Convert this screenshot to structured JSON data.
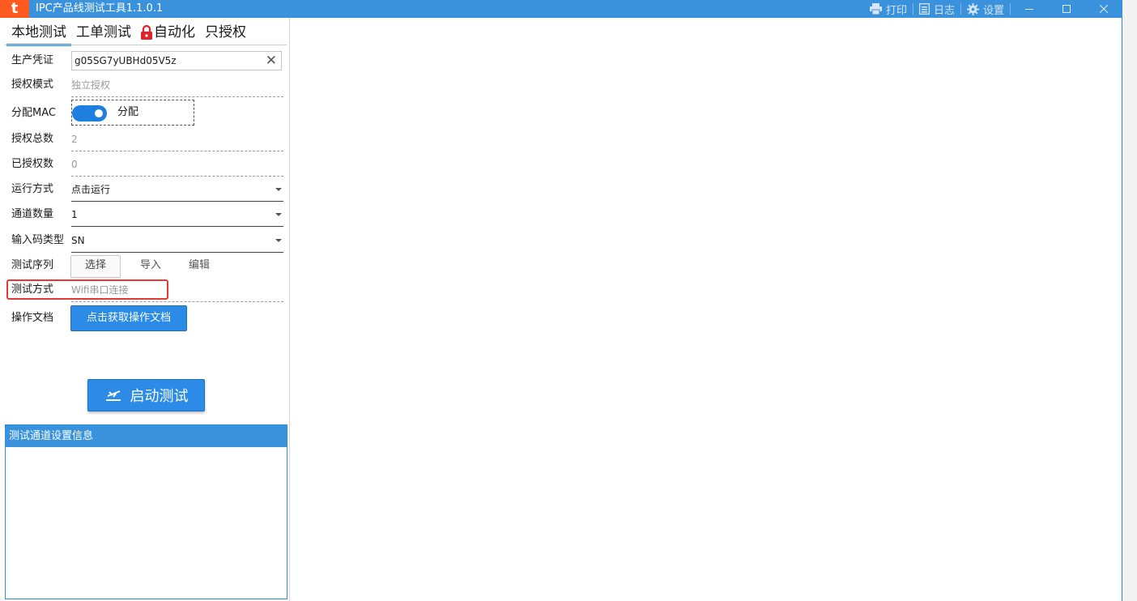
{
  "window": {
    "logo_char": "t",
    "title": "IPC产品线测试工具1.1.0.1",
    "toolbar": {
      "print_label": "打印",
      "log_label": "日志",
      "settings_label": "设置"
    }
  },
  "tabs": [
    {
      "label": "本地测试",
      "active": true
    },
    {
      "label": "工单测试",
      "active": false
    },
    {
      "label": "自动化",
      "active": false,
      "icon": "lock-icon"
    },
    {
      "label": "只授权",
      "active": false
    }
  ],
  "form": {
    "credential": {
      "label": "生产凭证",
      "value": "g05SG7yUBHd05V5z"
    },
    "auth_mode": {
      "label": "授权模式",
      "value": "独立授权"
    },
    "assign_mac": {
      "label": "分配MAC",
      "toggle_on": true,
      "toggle_text": "分配"
    },
    "auth_total": {
      "label": "授权总数",
      "value": "2"
    },
    "authorized_count": {
      "label": "已授权数",
      "value": "0"
    },
    "run_mode": {
      "label": "运行方式",
      "value": "点击运行"
    },
    "channel_count": {
      "label": "通道数量",
      "value": "1"
    },
    "input_code_type": {
      "label": "输入码类型",
      "value": "SN"
    },
    "test_sequence": {
      "label": "测试序列",
      "select": "选择",
      "import": "导入",
      "edit": "编辑"
    },
    "test_method": {
      "label": "测试方式",
      "value": "Wifi串口连接"
    },
    "operation_doc": {
      "label": "操作文档",
      "button": "点击获取操作文档"
    }
  },
  "start_button": "启动测试",
  "info_panel": {
    "title": "测试通道设置信息"
  },
  "colors": {
    "titlebar": "#3a92dc",
    "accent": "#2b8be6",
    "logo": "#ff5a1f",
    "highlight": "#e53935"
  }
}
